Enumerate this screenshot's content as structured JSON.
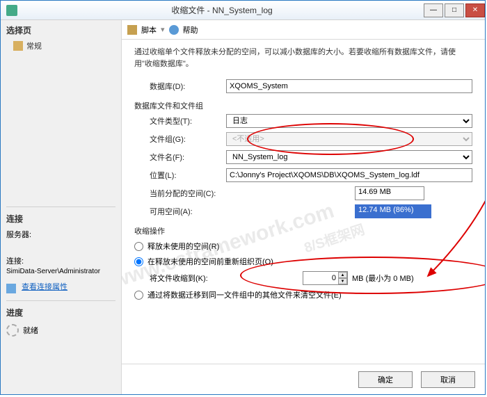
{
  "window": {
    "title": "收缩文件 - NN_System_log"
  },
  "left": {
    "select_page": "选择页",
    "general": "常规",
    "connection_header": "连接",
    "server_label": "服务器:",
    "server_value": "",
    "conn_label": "连接:",
    "conn_value": "SimiData-Server\\Administrator",
    "view_conn_props": "查看连接属性",
    "progress_header": "进度",
    "progress_status": "就绪"
  },
  "toolbar": {
    "script": "脚本",
    "help": "帮助"
  },
  "content": {
    "description": "通过收缩单个文件释放未分配的空间，可以减小数据库的大小。若要收缩所有数据库文件，请使用\"收缩数据库\"。",
    "database_label": "数据库(D):",
    "database_value": "XQOMS_System",
    "files_group_label": "数据库文件和文件组",
    "file_type_label": "文件类型(T):",
    "file_type_value": "日志",
    "file_group_label": "文件组(G):",
    "file_group_value": "<不适用>",
    "file_name_label": "文件名(F):",
    "file_name_value": "NN_System_log",
    "location_label": "位置(L):",
    "location_value": "C:\\Jonny's Project\\XQOMS\\DB\\XQOMS_System_log.ldf",
    "allocated_label": "当前分配的空间(C):",
    "allocated_value": "14.69 MB",
    "available_label": "可用空间(A):",
    "available_value": "12.74 MB (86%)",
    "shrink_action_label": "收缩操作",
    "opt_release": "释放未使用的空间(R)",
    "opt_reorg": "在释放未使用的空间前重新组织页(O)",
    "shrink_to_label": "将文件收缩到(K):",
    "shrink_to_value": "0",
    "shrink_to_unit": "MB (最小为 0 MB)",
    "opt_empty": "通过将数据迁移到同一文件组中的其他文件来清空文件(E)"
  },
  "buttons": {
    "ok": "确定",
    "cancel": "取消"
  },
  "watermark": {
    "line1": "www.csframework.com",
    "line2": "8/S框架网"
  }
}
